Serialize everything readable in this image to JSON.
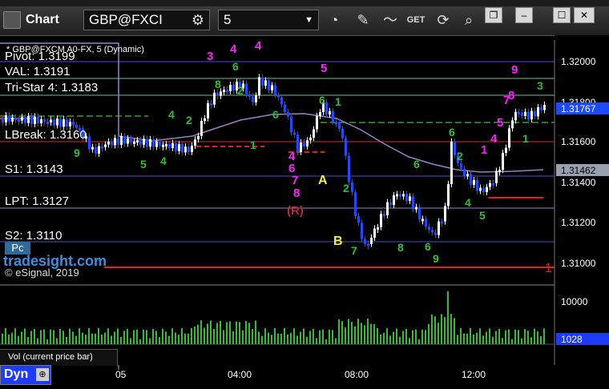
{
  "app": {
    "title": "Chart"
  },
  "toolbar": {
    "symbol": "GBP@FXCI",
    "interval": "5"
  },
  "window": {
    "restore": "❐",
    "min": "–",
    "max": "☐",
    "close": "✕"
  },
  "study_title": "* GBP@FXCM A0-FX, 5 (Dynamic)",
  "levels": {
    "pivot": "Pivot: 1.3199",
    "val": "VAL: 1.3191",
    "tristar": "Tri-Star 4: 1.3183",
    "lbreak": "LBreak: 1.3160",
    "s1": "S1: 1.3143",
    "lpt": "LPT: 1.3127",
    "s2": "S2: 1.3110"
  },
  "watermark": {
    "brand": "tradesight.com",
    "copyright": "© eSignal, 2019",
    "pc_button": "Pc"
  },
  "price_axis": {
    "ticks": [
      "1.32000",
      "1.31800",
      "1.31600",
      "1.31400",
      "1.31200",
      "1.31000"
    ],
    "last_price": "1.31767",
    "ma_price": "1.31462"
  },
  "annotations": {
    "a": "A",
    "b": "B",
    "r": "(R)",
    "red_one": "1"
  },
  "volume": {
    "label": "Vol (current price bar)",
    "axis_tick": "10000",
    "last": "1028"
  },
  "time_axis": {
    "labels": [
      "05",
      "04:00",
      "08:00",
      "12:00"
    ],
    "dyn": "Dyn"
  },
  "colors": {
    "up": "#ffffff",
    "down": "#1e4bff",
    "seq_green": "#2fbf2f",
    "seq_magenta": "#ff22ff",
    "ma": "#9a7fc8"
  }
}
